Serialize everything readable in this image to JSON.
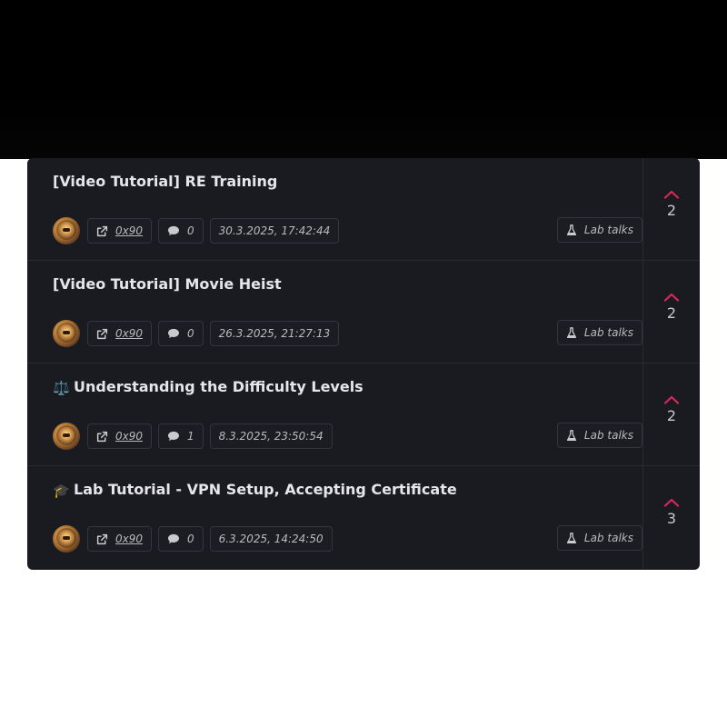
{
  "posts": [
    {
      "title": "[Video Tutorial] RE Training",
      "emoji": "",
      "author": "0x90",
      "comments": "0",
      "timestamp": "30.3.2025, 17:42:44",
      "category": "Lab talks",
      "votes": "2"
    },
    {
      "title": "[Video Tutorial] Movie Heist",
      "emoji": "",
      "author": "0x90",
      "comments": "0",
      "timestamp": "26.3.2025, 21:27:13",
      "category": "Lab talks",
      "votes": "2"
    },
    {
      "title": "Understanding the Difficulty Levels",
      "emoji": "⚖️",
      "author": "0x90",
      "comments": "1",
      "timestamp": "8.3.2025, 23:50:54",
      "category": "Lab talks",
      "votes": "2"
    },
    {
      "title": "Lab Tutorial - VPN Setup, Accepting Certificate",
      "emoji": "🎓",
      "author": "0x90",
      "comments": "0",
      "timestamp": "6.3.2025, 14:24:50",
      "category": "Lab talks",
      "votes": "3"
    }
  ],
  "icons": {
    "author_link": "external-link-icon",
    "comments": "comment-bubble-icon",
    "category": "flask-icon",
    "upvote": "chevron-up-icon"
  },
  "colors": {
    "panel_bg": "#1a1b20",
    "upvote_accent": "#d8285a",
    "title_text": "#e6e6ea",
    "meta_text": "#b9bac0"
  }
}
